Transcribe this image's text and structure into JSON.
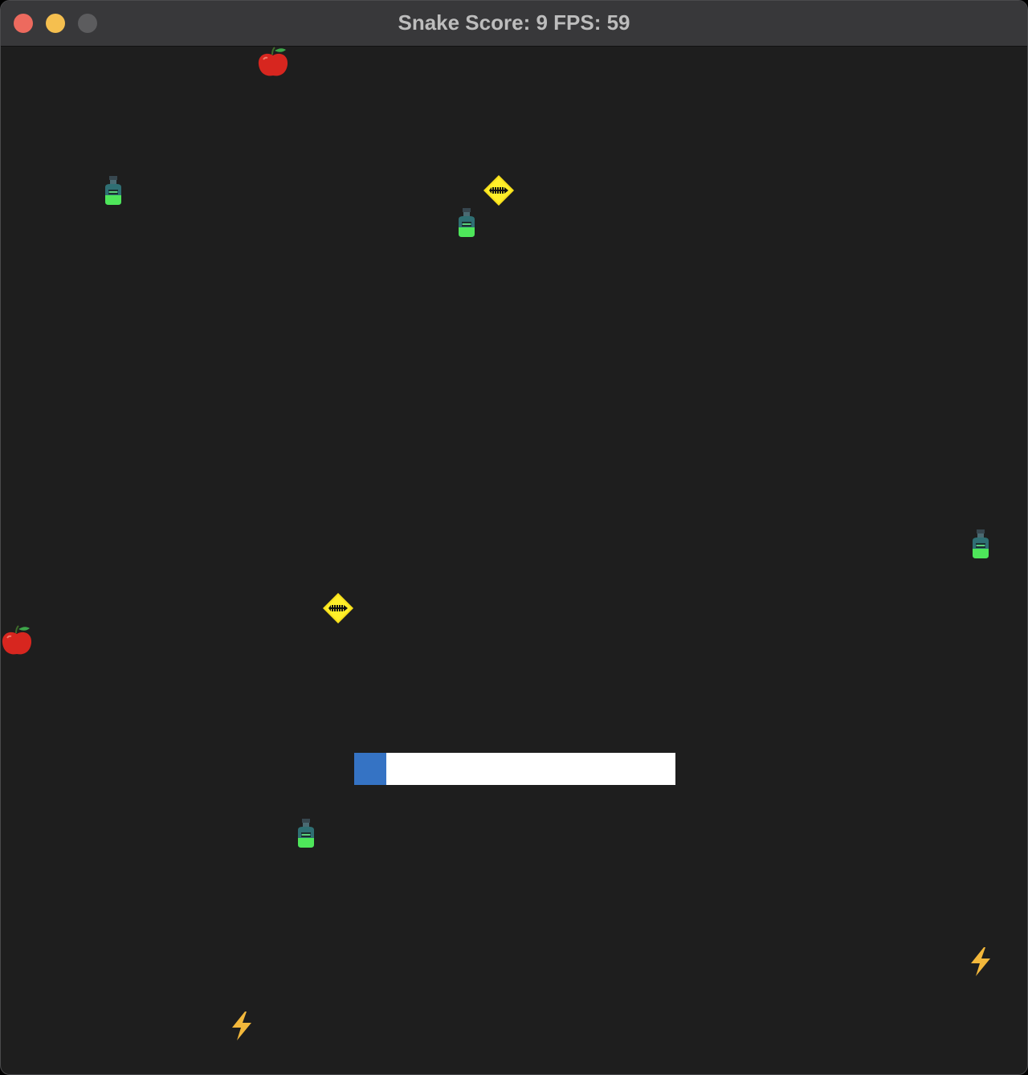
{
  "window": {
    "title": "Snake Score: 9 FPS: 59",
    "controls": [
      "close",
      "minimize",
      "maximize"
    ]
  },
  "game": {
    "score": 9,
    "fps": 59,
    "background_color": "#1e1e1e",
    "items": [
      {
        "type": "apple",
        "icon": "apple-icon"
      },
      {
        "type": "apple",
        "icon": "apple-icon"
      },
      {
        "type": "potion",
        "icon": "potion-icon"
      },
      {
        "type": "potion",
        "icon": "potion-icon"
      },
      {
        "type": "potion",
        "icon": "potion-icon"
      },
      {
        "type": "potion",
        "icon": "potion-icon"
      },
      {
        "type": "caution-sign",
        "icon": "caution-sign-icon"
      },
      {
        "type": "caution-sign",
        "icon": "caution-sign-icon"
      },
      {
        "type": "lightning",
        "icon": "lightning-bolt-icon"
      },
      {
        "type": "lightning",
        "icon": "lightning-bolt-icon"
      }
    ],
    "progress": {
      "fraction": 0.1,
      "fill_color": "#3573c4",
      "track_color": "#ffffff"
    }
  }
}
